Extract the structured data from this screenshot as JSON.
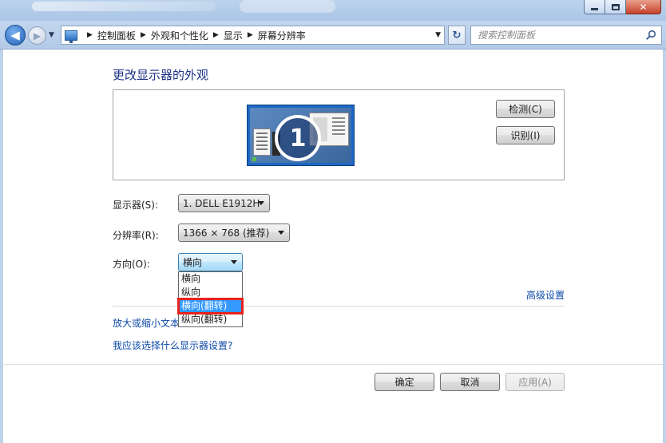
{
  "window": {
    "min_label": "",
    "max_label": "",
    "close_label": "✕"
  },
  "nav": {
    "back_glyph": "◀",
    "forward_glyph": "▶",
    "history_glyph": "▼",
    "breadcrumbs": [
      "控制面板",
      "外观和个性化",
      "显示",
      "屏幕分辨率"
    ],
    "crumb_separator": "▶",
    "address_dropdown_glyph": "▼",
    "refresh_glyph": "↻",
    "search_placeholder": "搜索控制面板"
  },
  "page": {
    "heading": "更改显示器的外观"
  },
  "preview": {
    "monitor_number": "1",
    "detect_button": "检测(C)",
    "identify_button": "识别(I)"
  },
  "settings": {
    "display_label": "显示器(S):",
    "display_value": "1. DELL E1912H",
    "resolution_label": "分辨率(R):",
    "resolution_value": "1366 × 768 (推荐)",
    "orientation_label": "方向(O):",
    "orientation_value": "横向",
    "orientation_options": [
      "横向",
      "纵向",
      "横向(翻转)",
      "纵向(翻转)"
    ],
    "orientation_highlighted_index": 2
  },
  "links": {
    "advanced_settings": "高级设置",
    "text_size": "放大或缩小文本",
    "which_settings": "我应该选择什么显示器设置?"
  },
  "footer": {
    "ok_button": "确定",
    "cancel_button": "取消",
    "apply_button": "应用(A)"
  },
  "colors": {
    "heading": "#1e3287",
    "link": "#0c49a8",
    "highlight_bg": "#3399ff",
    "highlight_border": "#e8221b",
    "monitor_blue": "#1d68c4"
  },
  "icons": {
    "address": "display-icon",
    "search": "search-icon",
    "refresh": "refresh-icon"
  }
}
